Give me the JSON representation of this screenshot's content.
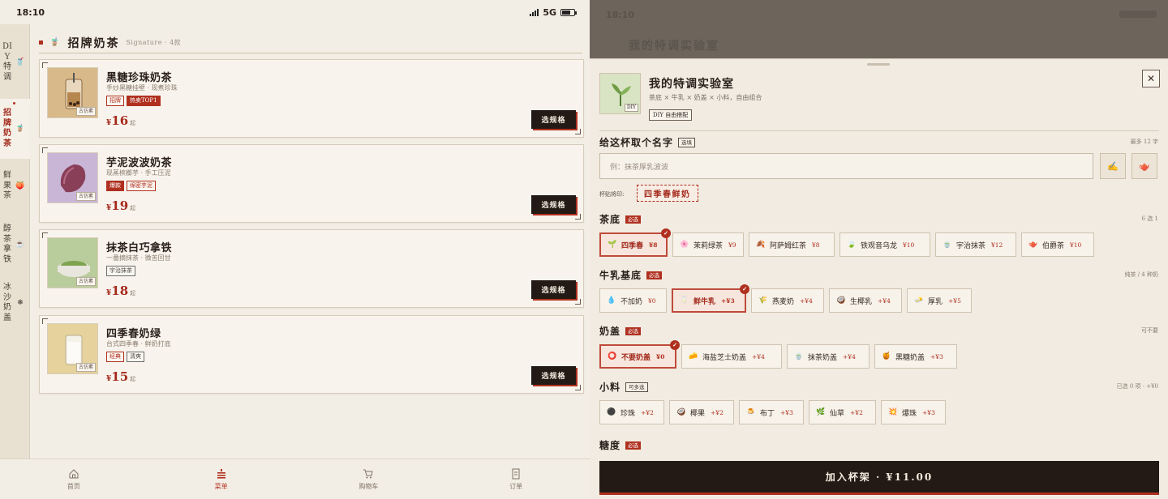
{
  "status": {
    "time": "18:10",
    "network": "5G"
  },
  "sidebar": [
    {
      "label": "DIY特调",
      "icon": "diy-cup-icon",
      "glyph": "🥤"
    },
    {
      "label": "招牌奶茶",
      "icon": "milk-tea-icon",
      "glyph": "🧋"
    },
    {
      "label": "鲜果茶",
      "icon": "fruit-icon",
      "glyph": "🍑"
    },
    {
      "label": "醇茶拿铁",
      "icon": "latte-icon",
      "glyph": "☕"
    },
    {
      "label": "冰沙奶盖",
      "icon": "ice-icon",
      "glyph": "❄"
    }
  ],
  "section": {
    "title": "招牌奶茶",
    "subtitle": "Signature · 4款"
  },
  "products": [
    {
      "name": "黑糖珍珠奶茶",
      "desc": "手炒黑糖挂壁 · 现煮珍珠",
      "tags": [
        {
          "text": "招牌",
          "style": "outline"
        },
        {
          "text": "热卖TOP1",
          "style": "solid"
        }
      ],
      "price": "16",
      "qi": "起",
      "thumb_tag": "古仿素"
    },
    {
      "name": "芋泥波波奶茶",
      "desc": "现蒸槟榔芋 · 手工压泥",
      "tags": [
        {
          "text": "爆款",
          "style": "solid"
        },
        {
          "text": "绵密芋泥",
          "style": "outline"
        }
      ],
      "price": "19",
      "qi": "起",
      "thumb_tag": "古仿素"
    },
    {
      "name": "抹茶白巧拿铁",
      "desc": "一番摘抹茶 · 微苦回甘",
      "tags": [
        {
          "text": "宇治抹茶",
          "style": "grey"
        }
      ],
      "price": "18",
      "qi": "起",
      "thumb_tag": "古仿素"
    },
    {
      "name": "四季春奶绿",
      "desc": "台式四季春 · 鲜奶打底",
      "tags": [
        {
          "text": "经典",
          "style": "outline"
        },
        {
          "text": "清爽",
          "style": "grey"
        }
      ],
      "price": "15",
      "qi": "起",
      "thumb_tag": "古仿素"
    }
  ],
  "currency": "¥",
  "choose_label": "选规格",
  "tabbar": [
    {
      "label": "首页",
      "icon": "home-icon"
    },
    {
      "label": "菜单",
      "icon": "menu-icon",
      "active": true
    },
    {
      "label": "购物车",
      "icon": "cart-icon"
    },
    {
      "label": "订单",
      "icon": "order-icon"
    }
  ],
  "sheet": {
    "title": "我的特调实验室",
    "subtitle": "茶底 × 牛乳 × 奶盖 × 小料，自由组合",
    "badge": "DIY 自由搭配",
    "thumb_tag": "DIY",
    "close": "✕",
    "name_title": "给这杯取个名字",
    "name_optional": "选填",
    "name_hint": "最多 12 字",
    "name_placeholder": "例：抹茶厚乳波波",
    "sticker_label": "杯贴将印:",
    "sticker_text": "四季春鲜奶",
    "groups": [
      {
        "title": "茶底",
        "badge": "必选",
        "hint": "6 选 1",
        "options": [
          {
            "icon": "sprout-icon",
            "glyph": "🌱",
            "label": "四季春",
            "price": "¥8",
            "selected": true
          },
          {
            "icon": "jasmine-icon",
            "glyph": "🌸",
            "label": "茉莉绿茶",
            "price": "¥9"
          },
          {
            "icon": "black-tea-icon",
            "glyph": "🍂",
            "label": "阿萨姆红茶",
            "price": "¥8"
          },
          {
            "icon": "oolong-icon",
            "glyph": "🍃",
            "label": "铁观音乌龙",
            "price": "¥10"
          },
          {
            "icon": "matcha-icon",
            "glyph": "🍵",
            "label": "宇治抹茶",
            "price": "¥12"
          },
          {
            "icon": "earl-grey-icon",
            "glyph": "🫖",
            "label": "伯爵茶",
            "price": "¥10"
          }
        ]
      },
      {
        "title": "牛乳基底",
        "badge": "必选",
        "hint": "纯茶 / 4 种奶",
        "options": [
          {
            "icon": "drop-icon",
            "glyph": "💧",
            "label": "不加奶",
            "price": "¥0"
          },
          {
            "icon": "milk-icon",
            "glyph": "🥛",
            "label": "鲜牛乳",
            "price": "+¥3",
            "selected": true
          },
          {
            "icon": "oat-icon",
            "glyph": "🌾",
            "label": "燕麦奶",
            "price": "+¥4"
          },
          {
            "icon": "coconut-icon",
            "glyph": "🥥",
            "label": "生椰乳",
            "price": "+¥4"
          },
          {
            "icon": "butter-icon",
            "glyph": "🧈",
            "label": "厚乳",
            "price": "+¥5"
          }
        ]
      },
      {
        "title": "奶盖",
        "badge": "必选",
        "hint": "可不要",
        "options": [
          {
            "icon": "none-icon",
            "glyph": "⭕",
            "label": "不要奶盖",
            "price": "¥0",
            "selected": true
          },
          {
            "icon": "cheese-icon",
            "glyph": "🧀",
            "label": "海盐芝士奶盖",
            "price": "+¥4"
          },
          {
            "icon": "matcha-foam-icon",
            "glyph": "🍵",
            "label": "抹茶奶盖",
            "price": "+¥4"
          },
          {
            "icon": "brown-sugar-icon",
            "glyph": "🍯",
            "label": "黑糖奶盖",
            "price": "+¥3"
          }
        ]
      },
      {
        "title": "小料",
        "badge": "可多选",
        "badge_style": "outline",
        "hint": "已选 0 项 · +¥0",
        "options": [
          {
            "icon": "pearl-icon",
            "glyph": "⚫",
            "label": "珍珠",
            "price": "+¥2"
          },
          {
            "icon": "coconut-jelly-icon",
            "glyph": "🥥",
            "label": "椰果",
            "price": "+¥2"
          },
          {
            "icon": "pudding-icon",
            "glyph": "🍮",
            "label": "布丁",
            "price": "+¥3"
          },
          {
            "icon": "grass-jelly-icon",
            "glyph": "🌿",
            "label": "仙草",
            "price": "+¥2"
          },
          {
            "icon": "popping-boba-icon",
            "glyph": "💥",
            "label": "爆珠",
            "price": "+¥3"
          }
        ]
      }
    ],
    "sugar_title": "糖度",
    "sugar_badge": "必选",
    "cart_label": "加入杯架 · ¥11.00"
  },
  "dim_title": "我的特调实验室",
  "colors": {
    "accent": "#b0301f",
    "dark": "#231a15",
    "paper": "#f3eee5"
  }
}
